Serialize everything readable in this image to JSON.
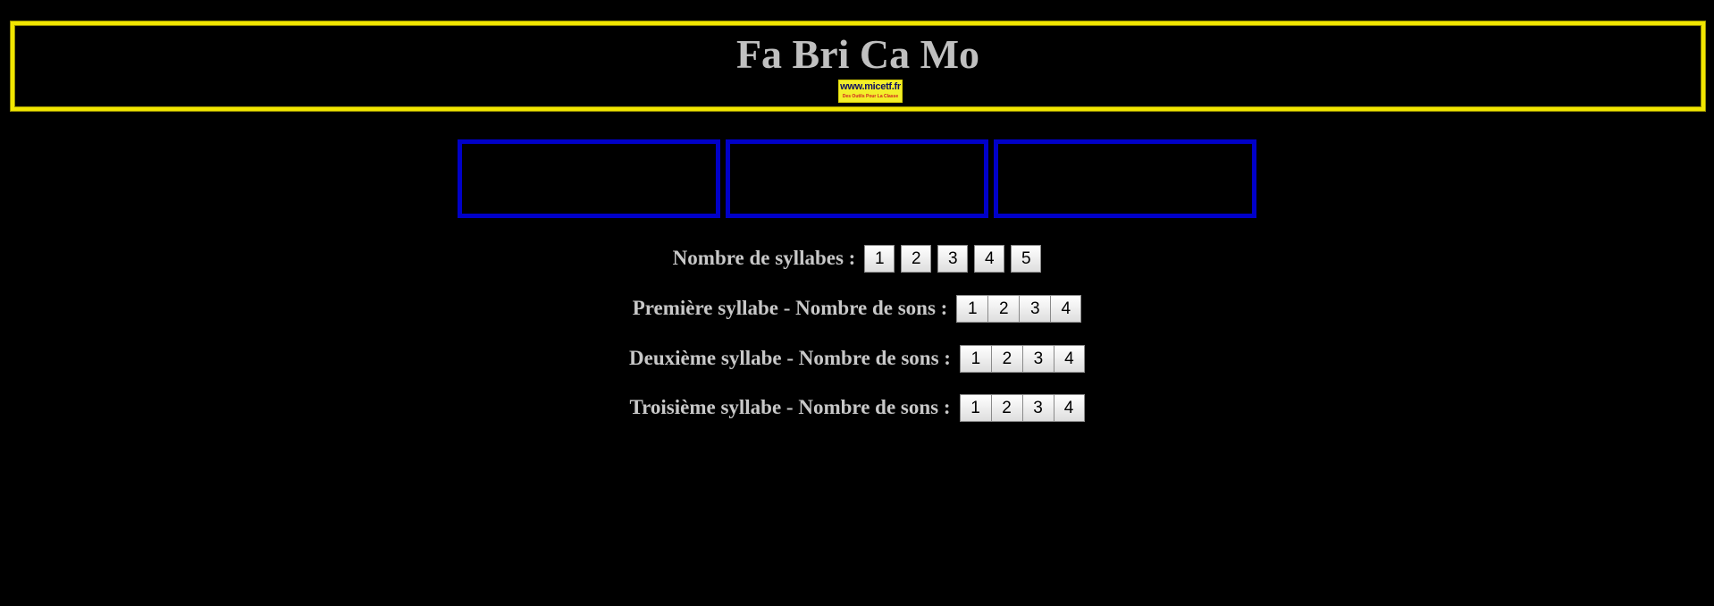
{
  "header": {
    "title": "Fa Bri Ca Mo",
    "logo_text": "www.micetf.fr",
    "logo_subtext": "Des Outils Pour La Classe"
  },
  "syllable_boxes": [
    "",
    "",
    ""
  ],
  "rows": [
    {
      "label": "Nombre de syllabes :",
      "options": [
        "1",
        "2",
        "3",
        "4",
        "5"
      ]
    },
    {
      "label": "Première syllabe - Nombre de sons :",
      "options": [
        "1",
        "2",
        "3",
        "4"
      ]
    },
    {
      "label": "Deuxième syllabe - Nombre de sons :",
      "options": [
        "1",
        "2",
        "3",
        "4"
      ]
    },
    {
      "label": "Troisième syllabe - Nombre de sons :",
      "options": [
        "1",
        "2",
        "3",
        "4"
      ]
    }
  ],
  "colors": {
    "background": "#000000",
    "header_border": "#f2e600",
    "syllable_box_border": "#0000c8",
    "text": "#c8c8c8"
  }
}
